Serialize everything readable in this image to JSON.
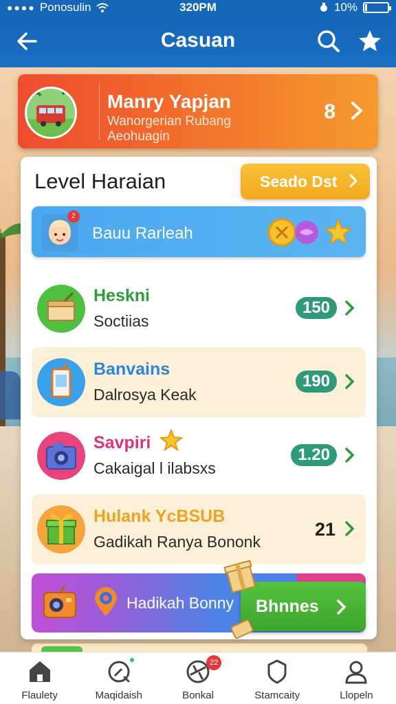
{
  "statusbar": {
    "carrier": "Ponosulin",
    "time": "320PM",
    "battery_text": "10%",
    "battery_level": 0.1
  },
  "header": {
    "title": "Casuan",
    "back_icon": "arrow-left-icon",
    "search_icon": "search-icon",
    "star_icon": "star-icon"
  },
  "profile": {
    "name": "Manry Yapjan",
    "subtitle_line1": "Wanorgerian Rubang",
    "subtitle_line2": "Aeohuagin",
    "count": "8"
  },
  "panel": {
    "title": "Level Haraian",
    "season_button": "Seado Dst",
    "banner": {
      "label": "Bauu Rarleah",
      "badge": "2"
    },
    "rows": [
      {
        "title": "Heskni",
        "desc": "Soctiias",
        "value": "150",
        "title_color": "#2f9d3a",
        "icon": "lunchbox-icon",
        "icon_bg": "#4fbf3f"
      },
      {
        "title": "Banvains",
        "desc": "Dalrosya Keak",
        "value": "190",
        "title_color": "#2a86d6",
        "icon": "juice-box-icon",
        "icon_bg": "#3aa0ea"
      },
      {
        "title": "Savpiri",
        "desc": "Cakaigal l ilabsxs",
        "value": "1.20",
        "title_color": "#d8357d",
        "icon": "camera-icon",
        "icon_bg": "#e9437d"
      },
      {
        "title": "Hulank YcBSUB",
        "desc": "Gadikah Ranya Bononk",
        "value": "21",
        "title_color": "#f0a21e",
        "icon": "gift-box-icon",
        "icon_bg": "#f4a43a"
      }
    ],
    "gift_bar": {
      "label": "Hadikah Bonny",
      "button": "Bhnnes"
    }
  },
  "bottom_nav": [
    {
      "label": "Flaulety",
      "icon": "home-icon"
    },
    {
      "label": "Maqidaish",
      "icon": "compass-icon"
    },
    {
      "label": "Bonkal",
      "icon": "plane-icon",
      "badge": "22"
    },
    {
      "label": "Stamcaity",
      "icon": "shield-icon"
    },
    {
      "label": "Llopeln",
      "icon": "person-icon"
    }
  ],
  "colors": {
    "header_blue": "#1565b8",
    "profile_orange": "#f26a2c",
    "season_yellow": "#f2a91e",
    "pill_teal": "#2f9a7a",
    "claim_green": "#3da42c"
  }
}
